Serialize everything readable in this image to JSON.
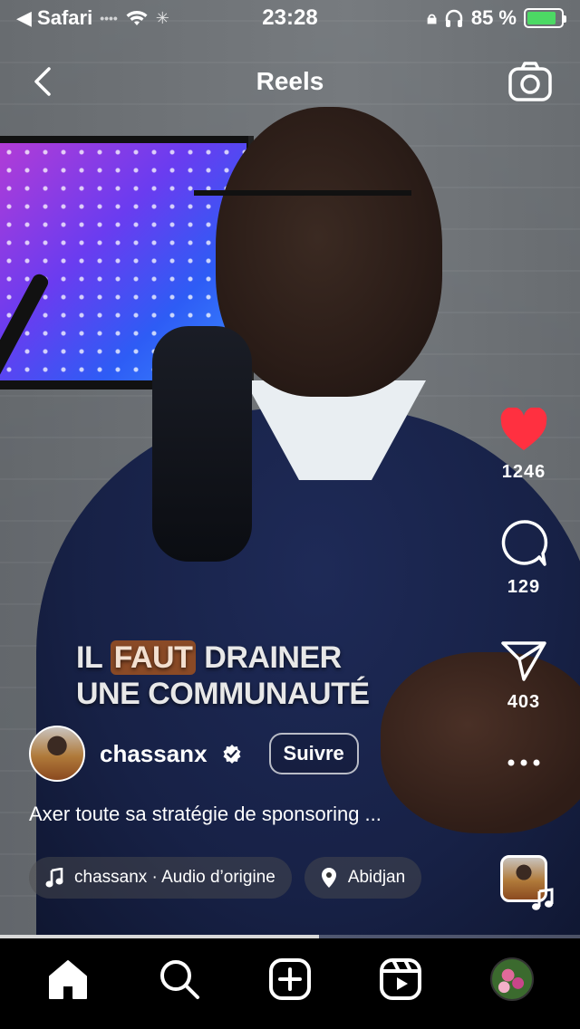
{
  "status_bar": {
    "back_app": "◀ Safari",
    "time": "23:28",
    "battery_percent": "85 %",
    "battery_level": 0.85
  },
  "header": {
    "title": "Reels"
  },
  "overlay": {
    "line1_pre": "IL",
    "line1_highlight": "FAUT",
    "line1_post": "DRAINER",
    "line2": "UNE COMMUNAUTÉ"
  },
  "actions": {
    "likes": "1246",
    "comments": "129",
    "shares": "403"
  },
  "post": {
    "username": "chassanx",
    "follow_label": "Suivre",
    "caption": "Axer toute sa stratégie de sponsoring ...",
    "audio_label": "chassanx · Audio d’origine",
    "location_label": "Abidjan"
  },
  "playback": {
    "progress": 0.55
  },
  "colors": {
    "like_red": "#ff3040",
    "highlight": "#8a4a26",
    "battery_green": "#4cd964"
  },
  "icons": {
    "back": "chevron-left-icon",
    "camera": "camera-icon",
    "like": "heart-icon",
    "comment": "comment-bubble-icon",
    "share": "paper-plane-icon",
    "more": "more-dots-icon",
    "home": "home-icon",
    "search": "search-icon",
    "create": "plus-square-icon",
    "reels": "reels-icon"
  }
}
